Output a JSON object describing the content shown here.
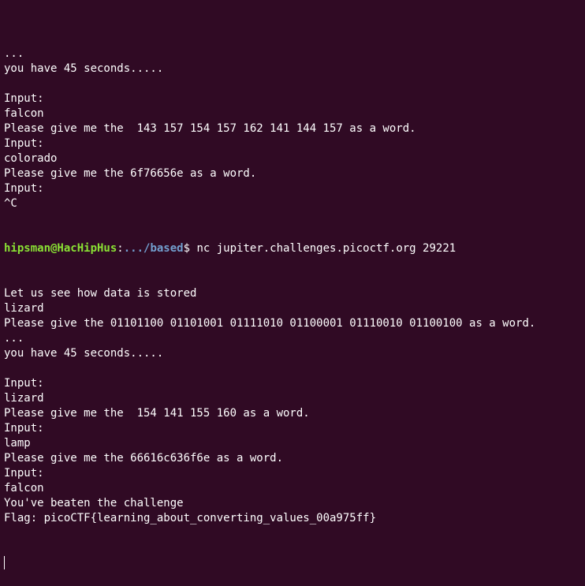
{
  "colors": {
    "background": "#300a24",
    "text": "#ffffff",
    "prompt_user": "#8ae234",
    "prompt_path": "#729fcf"
  },
  "terminal": {
    "lines_before": [
      "...",
      "you have 45 seconds.....",
      "",
      "Input:",
      "falcon",
      "Please give me the  143 157 154 157 162 141 144 157 as a word.",
      "Input:",
      "colorado",
      "Please give me the 6f76656e as a word.",
      "Input:",
      "^C"
    ],
    "prompt": {
      "user_host": "hipsman@HacHipHus",
      "separator": ":",
      "path": ".../based",
      "symbol": "$",
      "command": " nc jupiter.challenges.picoctf.org 29221"
    },
    "lines_after": [
      "Let us see how data is stored",
      "lizard",
      "Please give the 01101100 01101001 01111010 01100001 01110010 01100100 as a word.",
      "...",
      "you have 45 seconds.....",
      "",
      "Input:",
      "lizard",
      "Please give me the  154 141 155 160 as a word.",
      "Input:",
      "lamp",
      "Please give me the 66616c636f6e as a word.",
      "Input:",
      "falcon",
      "You've beaten the challenge",
      "Flag: picoCTF{learning_about_converting_values_00a975ff}"
    ]
  }
}
